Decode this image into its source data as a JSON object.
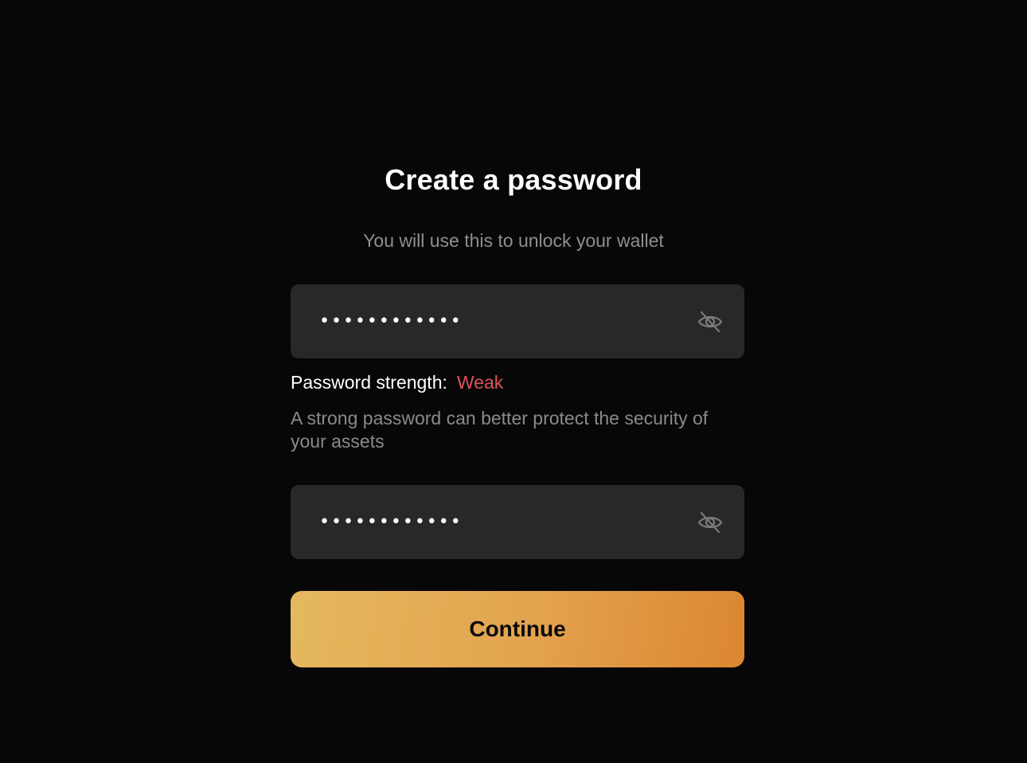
{
  "header": {
    "title": "Create a password",
    "subtitle": "You will use this to unlock your wallet"
  },
  "password_field": {
    "value": "••••••••••••",
    "toggle_icon": "eye-off-icon"
  },
  "strength": {
    "label": "Password strength:",
    "value": "Weak",
    "value_color": "#e2505a"
  },
  "hint": "A strong password can better protect the security of your assets",
  "confirm_field": {
    "value": "••••••••••••",
    "toggle_icon": "eye-off-icon"
  },
  "continue_button": {
    "label": "Continue"
  },
  "colors": {
    "background": "#070707",
    "field_background": "#292827",
    "accent_gradient_start": "#e4b95f",
    "accent_gradient_end": "#db8630"
  }
}
